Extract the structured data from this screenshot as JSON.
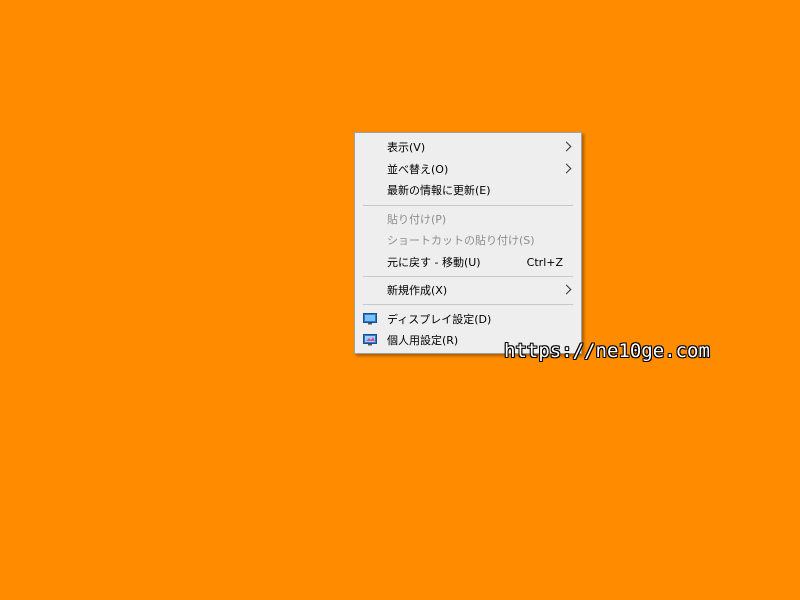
{
  "colors": {
    "desktop_background": "#ff8c00",
    "menu_background": "#eeeeee",
    "disabled_text": "#8d8d8d"
  },
  "context_menu": {
    "items": [
      {
        "label": "表示(V)",
        "submenu": true
      },
      {
        "label": "並べ替え(O)",
        "submenu": true
      },
      {
        "label": "最新の情報に更新(E)"
      },
      {
        "label": "貼り付け(P)",
        "disabled": true
      },
      {
        "label": "ショートカットの貼り付け(S)",
        "disabled": true
      },
      {
        "label": "元に戻す - 移動(U)",
        "shortcut": "Ctrl+Z"
      },
      {
        "label": "新規作成(X)",
        "submenu": true
      },
      {
        "label": "ディスプレイ設定(D)",
        "icon": "display-settings-icon"
      },
      {
        "label": "個人用設定(R)",
        "icon": "personalize-icon"
      }
    ]
  },
  "watermark": {
    "text": "https://ne10ge.com"
  }
}
